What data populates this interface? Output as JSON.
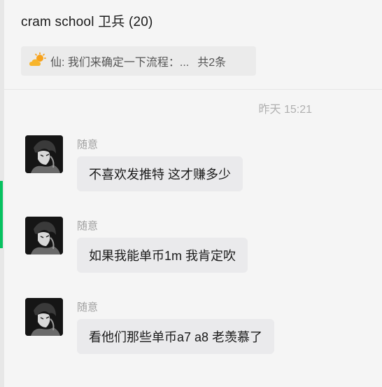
{
  "chat": {
    "title": "cram school 卫兵 (20)",
    "pinned": {
      "icon": "sun-cloud-icon",
      "text": "仙: 我们来确定一下流程：...",
      "count": "共2条"
    },
    "timestamp": "昨天 15:21"
  },
  "messages": [
    {
      "sender": "随意",
      "text": "不喜欢发推特 这才赚多少"
    },
    {
      "sender": "随意",
      "text": "如果我能单币1m  我肯定吹"
    },
    {
      "sender": "随意",
      "text": "看他们那些单币a7 a8 老羡慕了"
    }
  ],
  "colors": {
    "accent": "#07c160",
    "bubble": "#eaeaec",
    "background": "#f5f5f5"
  }
}
